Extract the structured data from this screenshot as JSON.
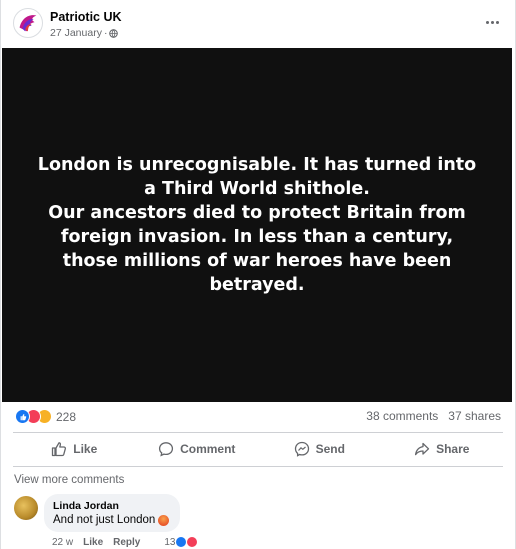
{
  "post": {
    "page_name": "Patriotic UK",
    "date": "27 January",
    "separator": "·",
    "body_lines": [
      "London is unrecognisable. It has turned into a Third World shithole.",
      "Our ancestors died to protect Britain from foreign invasion. In less than a century, those millions of war heroes have been betrayed."
    ]
  },
  "stats": {
    "reaction_count": "228",
    "comments": "38 comments",
    "shares": "37 shares"
  },
  "actions": {
    "like": "Like",
    "comment": "Comment",
    "send": "Send",
    "share": "Share"
  },
  "comments_section": {
    "view_more": "View more comments",
    "items": [
      {
        "author": "Linda Jordan",
        "text": "And not just London",
        "age": "22 w",
        "like_label": "Like",
        "reply_label": "Reply",
        "reaction_count": "13"
      }
    ]
  },
  "icons": {
    "avatar": "patriotic-uk-logo",
    "audience": "globe-icon",
    "menu": "more-options-icon",
    "like": "thumbs-up-icon",
    "comment": "speech-bubble-icon",
    "send": "messenger-icon",
    "share": "share-arrow-icon"
  },
  "colors": {
    "media_bg": "#101010",
    "like_blue": "#1877f2",
    "angry_red": "#f33e58",
    "sad_yellow": "#f7b125",
    "secondary_text": "#65676b"
  }
}
